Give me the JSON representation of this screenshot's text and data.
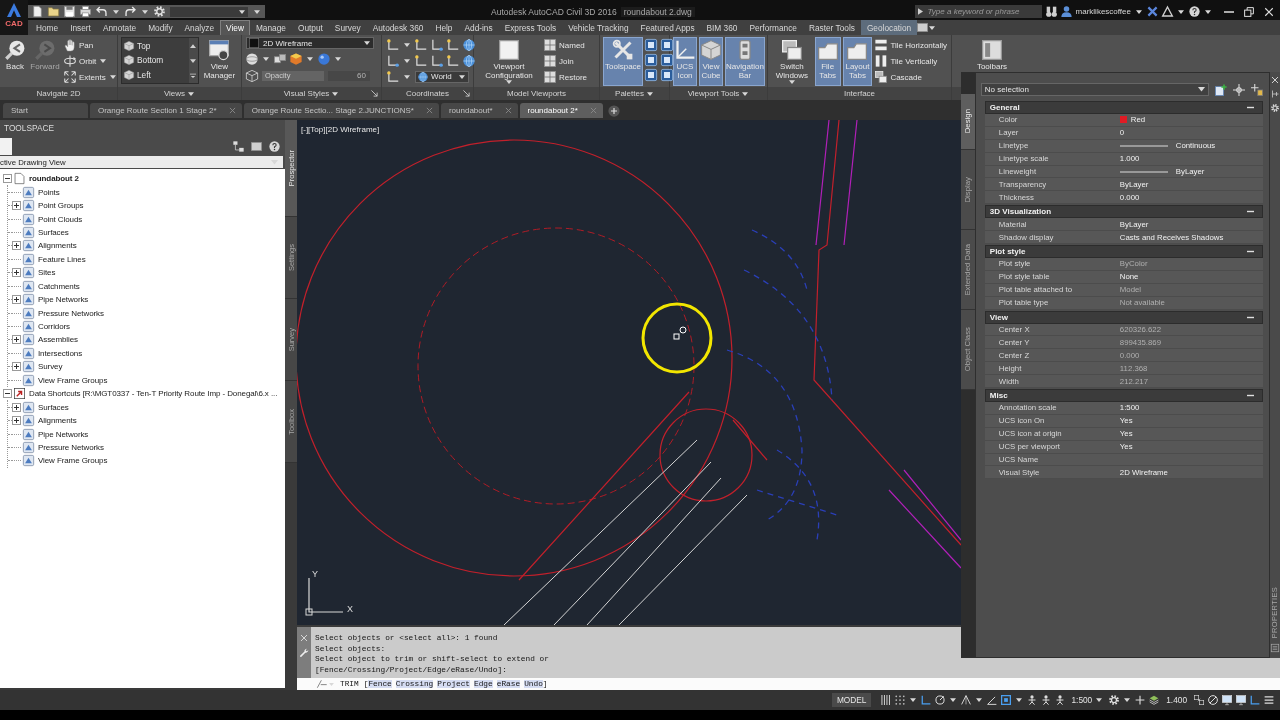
{
  "title_bar": {
    "app_label": "CAD",
    "title": "Autodesk AutoCAD Civil 3D 2016",
    "filename": "roundabout 2.dwg",
    "search": {
      "placeholder": "Type a keyword or phrase"
    },
    "user": "marklikescoffee"
  },
  "ribbon_tabs": [
    {
      "label": "Home",
      "selected": false,
      "contextual": false
    },
    {
      "label": "Insert",
      "selected": false,
      "contextual": false
    },
    {
      "label": "Annotate",
      "selected": false,
      "contextual": false
    },
    {
      "label": "Modify",
      "selected": false,
      "contextual": false
    },
    {
      "label": "Analyze",
      "selected": false,
      "contextual": false
    },
    {
      "label": "View",
      "selected": true,
      "contextual": false
    },
    {
      "label": "Manage",
      "selected": false,
      "contextual": false
    },
    {
      "label": "Output",
      "selected": false,
      "contextual": false
    },
    {
      "label": "Survey",
      "selected": false,
      "contextual": false
    },
    {
      "label": "Autodesk 360",
      "selected": false,
      "contextual": false
    },
    {
      "label": "Help",
      "selected": false,
      "contextual": false
    },
    {
      "label": "Add-ins",
      "selected": false,
      "contextual": false
    },
    {
      "label": "Express Tools",
      "selected": false,
      "contextual": false
    },
    {
      "label": "Vehicle Tracking",
      "selected": false,
      "contextual": false
    },
    {
      "label": "Featured Apps",
      "selected": false,
      "contextual": false
    },
    {
      "label": "BIM 360",
      "selected": false,
      "contextual": false
    },
    {
      "label": "Performance",
      "selected": false,
      "contextual": false
    },
    {
      "label": "Raster Tools",
      "selected": false,
      "contextual": false
    },
    {
      "label": "Geolocation",
      "selected": false,
      "contextual": true
    }
  ],
  "ribbon_panels": [
    {
      "kind": "navigate",
      "title": "Navigate 2D",
      "menu": false,
      "launcher": false,
      "large": [
        {
          "label": "Back",
          "on": false,
          "menu": false,
          "disabled": false
        },
        {
          "label": "Forward",
          "on": false,
          "menu": false,
          "disabled": true
        }
      ],
      "small": [
        {
          "label": "Pan",
          "menu": false
        },
        {
          "label": "Orbit",
          "menu": true
        },
        {
          "label": "Extents",
          "menu": true
        }
      ]
    },
    {
      "kind": "views",
      "title": "Views",
      "menu": true,
      "launcher": false,
      "list": [
        "Top",
        "Bottom",
        "Left"
      ],
      "large": [
        {
          "label": "View Manager",
          "on": false,
          "menu": false,
          "disabled": false
        }
      ]
    },
    {
      "kind": "visual_styles",
      "title": "Visual Styles",
      "menu": true,
      "launcher": true,
      "style": "2D Wireframe",
      "opacity": {
        "label": "Opacity",
        "value": "60",
        "disabled": true
      }
    },
    {
      "kind": "coordinates",
      "title": "Coordinates",
      "menu": false,
      "launcher": true,
      "ucs": "World"
    },
    {
      "kind": "viewports",
      "title": "Model Viewports",
      "menu": false,
      "launcher": false,
      "large": [
        {
          "label": "Viewport Configuration",
          "on": false,
          "menu": true,
          "disabled": false
        }
      ],
      "small": [
        {
          "label": "Named",
          "menu": false
        },
        {
          "label": "Join",
          "menu": false
        },
        {
          "label": "Restore",
          "menu": false
        }
      ]
    },
    {
      "kind": "palettes",
      "title": "Palettes",
      "menu": true,
      "launcher": false,
      "large": [
        {
          "label": "Toolspace",
          "on": true,
          "menu": false,
          "disabled": false
        }
      ]
    },
    {
      "kind": "viewport_tools",
      "title": "Viewport Tools",
      "menu": true,
      "launcher": false,
      "large": [
        {
          "label": "UCS Icon",
          "on": true,
          "menu": false,
          "disabled": false
        },
        {
          "label": "View Cube",
          "on": true,
          "menu": false,
          "disabled": false
        },
        {
          "label": "Navigation Bar",
          "on": true,
          "menu": false,
          "disabled": false
        }
      ]
    },
    {
      "kind": "interface",
      "title": "Interface",
      "menu": false,
      "launcher": false,
      "large": [
        {
          "label": "Switch Windows",
          "on": false,
          "menu": true,
          "disabled": false
        },
        {
          "label": "File Tabs",
          "on": true,
          "menu": false,
          "disabled": false
        },
        {
          "label": "Layout Tabs",
          "on": true,
          "menu": false,
          "disabled": false
        }
      ],
      "small": [
        {
          "label": "Tile Horizontally",
          "menu": false
        },
        {
          "label": "Tile Vertically",
          "menu": false
        },
        {
          "label": "Cascade",
          "menu": false
        }
      ]
    },
    {
      "kind": "toolbars",
      "large": [
        {
          "label": "Toolbars",
          "on": false,
          "menu": false,
          "disabled": false
        }
      ]
    }
  ],
  "file_tabs": [
    {
      "label": "Start",
      "selected": false,
      "closable": false
    },
    {
      "label": "Orange Route Section 1 Stage 2*",
      "selected": false,
      "closable": true
    },
    {
      "label": "Orange Route Sectio... Stage 2.JUNCTIONS*",
      "selected": false,
      "closable": true
    },
    {
      "label": "roundabout*",
      "selected": false,
      "closable": true
    },
    {
      "label": "roundabout 2*",
      "selected": true,
      "closable": true
    }
  ],
  "toolspace": {
    "title": "TOOLSPACE",
    "view": "ctive Drawing View",
    "tabs": [
      {
        "label": "Prospector",
        "selected": true
      },
      {
        "label": "Settings",
        "selected": false
      },
      {
        "label": "Survey",
        "selected": false
      },
      {
        "label": "Toolbox",
        "selected": false
      }
    ],
    "tree": [
      {
        "label": "roundabout 2",
        "current": true,
        "expanded": true,
        "children": [
          {
            "label": "Points"
          },
          {
            "label": "Point Groups",
            "expanded": false
          },
          {
            "label": "Point Clouds"
          },
          {
            "label": "Surfaces"
          },
          {
            "label": "Alignments",
            "expanded": false
          },
          {
            "label": "Feature Lines"
          },
          {
            "label": "Sites",
            "expanded": false
          },
          {
            "label": "Catchments"
          },
          {
            "label": "Pipe Networks",
            "expanded": false
          },
          {
            "label": "Pressure Networks"
          },
          {
            "label": "Corridors"
          },
          {
            "label": "Assemblies",
            "expanded": false
          },
          {
            "label": "Intersections"
          },
          {
            "label": "Survey",
            "expanded": false
          },
          {
            "label": "View Frame Groups"
          }
        ]
      },
      {
        "label": "Data Shortcuts [R:\\MGT0337 - Ten-T Priority Route Imp - Donegal\\6.x ...",
        "current": false,
        "expanded": true,
        "children": [
          {
            "label": "Surfaces",
            "expanded": false
          },
          {
            "label": "Alignments",
            "expanded": false
          },
          {
            "label": "Pipe Networks"
          },
          {
            "label": "Pressure Networks"
          },
          {
            "label": "View Frame Groups"
          }
        ]
      }
    ]
  },
  "viewport": {
    "label": "[-][Top][2D Wireframe]",
    "ucs_x": "X",
    "ucs_y": "Y"
  },
  "command_line": {
    "history": [
      "Select objects or <select all>: 1 found",
      "Select objects:",
      "Select object to trim or shift-select to extend or",
      "[Fence/Crossing/Project/Edge/eRase/Undo]:"
    ],
    "command": "TRIM",
    "open_bracket": "[",
    "options": [
      "Fence",
      "Crossing",
      "Project",
      "Edge",
      "eRase",
      "Undo"
    ],
    "close_bracket": "]"
  },
  "properties": {
    "title": "PROPERTIES",
    "selection": "No selection",
    "tabs": [
      {
        "label": "Design",
        "selected": true
      },
      {
        "label": "Display",
        "selected": false
      },
      {
        "label": "Extended Data",
        "selected": false
      },
      {
        "label": "Object Class",
        "selected": false
      }
    ],
    "sections": [
      {
        "title": "General",
        "expanded": true,
        "rows": [
          {
            "name": "Color",
            "value": "Red",
            "kind": "color",
            "color": "#e01b24",
            "disabled": false
          },
          {
            "name": "Layer",
            "value": "0",
            "kind": "text",
            "disabled": false
          },
          {
            "name": "Linetype",
            "value": "Continuous",
            "kind": "line",
            "disabled": false
          },
          {
            "name": "Linetype scale",
            "value": "1.000",
            "kind": "text",
            "disabled": false
          },
          {
            "name": "Lineweight",
            "value": "ByLayer",
            "kind": "line",
            "disabled": false
          },
          {
            "name": "Transparency",
            "value": "ByLayer",
            "kind": "text",
            "disabled": false
          },
          {
            "name": "Thickness",
            "value": "0.000",
            "kind": "text",
            "disabled": false
          }
        ]
      },
      {
        "title": "3D Visualization",
        "expanded": true,
        "rows": [
          {
            "name": "Material",
            "value": "ByLayer",
            "kind": "text",
            "disabled": false
          },
          {
            "name": "Shadow display",
            "value": "Casts and Receives Shadows",
            "kind": "text",
            "disabled": false
          }
        ]
      },
      {
        "title": "Plot style",
        "expanded": true,
        "rows": [
          {
            "name": "Plot style",
            "value": "ByColor",
            "kind": "text",
            "disabled": true
          },
          {
            "name": "Plot style table",
            "value": "None",
            "kind": "text",
            "disabled": false
          },
          {
            "name": "Plot table attached to",
            "value": "Model",
            "kind": "text",
            "disabled": true
          },
          {
            "name": "Plot table type",
            "value": "Not available",
            "kind": "text",
            "disabled": true
          }
        ]
      },
      {
        "title": "View",
        "expanded": true,
        "rows": [
          {
            "name": "Center X",
            "value": "620326.622",
            "kind": "text",
            "disabled": true
          },
          {
            "name": "Center Y",
            "value": "899435.869",
            "kind": "text",
            "disabled": true
          },
          {
            "name": "Center Z",
            "value": "0.000",
            "kind": "text",
            "disabled": true
          },
          {
            "name": "Height",
            "value": "112.368",
            "kind": "text",
            "disabled": true
          },
          {
            "name": "Width",
            "value": "212.217",
            "kind": "text",
            "disabled": true
          }
        ]
      },
      {
        "title": "Misc",
        "expanded": true,
        "rows": [
          {
            "name": "Annotation scale",
            "value": "1:500",
            "kind": "text",
            "disabled": false
          },
          {
            "name": "UCS icon On",
            "value": "Yes",
            "kind": "text",
            "disabled": false
          },
          {
            "name": "UCS icon at origin",
            "value": "Yes",
            "kind": "text",
            "disabled": false
          },
          {
            "name": "UCS per viewport",
            "value": "Yes",
            "kind": "text",
            "disabled": false
          },
          {
            "name": "UCS Name",
            "kind": "text"
          },
          {
            "name": "Visual Style",
            "value": "2D Wireframe",
            "kind": "text",
            "disabled": false
          }
        ]
      }
    ]
  },
  "status_bar": {
    "space": "MODEL",
    "annotation_scale": "1:500",
    "readout": "1.400"
  }
}
